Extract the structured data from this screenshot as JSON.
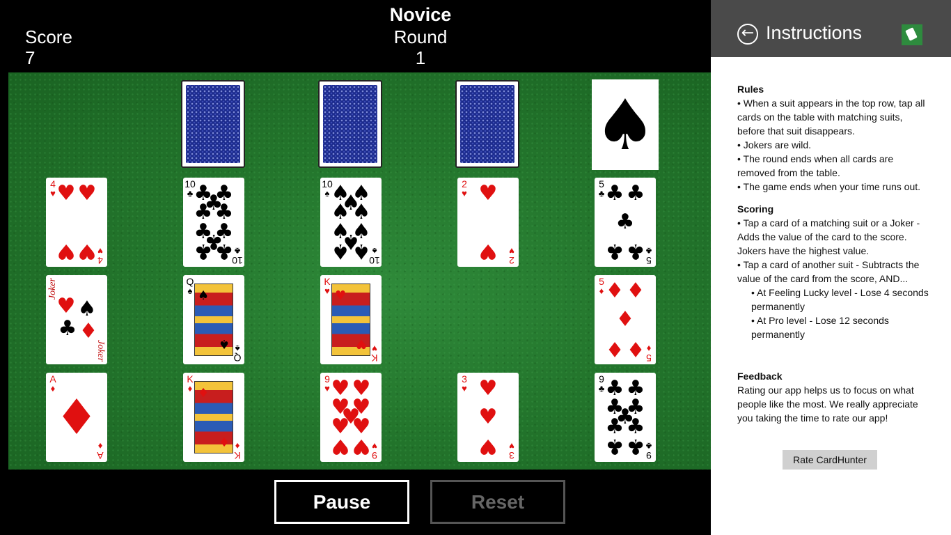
{
  "header": {
    "score_label": "Score",
    "score_value": "7",
    "level": "Novice",
    "round_label": "Round",
    "round_value": "1"
  },
  "top_row": {
    "face_down_cards": 3,
    "active_suit": "♠"
  },
  "table_cards": [
    {
      "rank": "4",
      "suit": "♥",
      "color": "red"
    },
    {
      "rank": "10",
      "suit": "♣",
      "color": "black"
    },
    {
      "rank": "10",
      "suit": "♠",
      "color": "black"
    },
    {
      "rank": "2",
      "suit": "♥",
      "color": "red"
    },
    {
      "rank": "5",
      "suit": "♣",
      "color": "black"
    },
    {
      "rank": "Joker",
      "suit": "",
      "color": "red"
    },
    {
      "rank": "Q",
      "suit": "♠",
      "color": "black"
    },
    {
      "rank": "K",
      "suit": "♥",
      "color": "red"
    },
    {
      "rank": "",
      "suit": "",
      "color": ""
    },
    {
      "rank": "5",
      "suit": "♦",
      "color": "red"
    },
    {
      "rank": "A",
      "suit": "♦",
      "color": "red"
    },
    {
      "rank": "K",
      "suit": "♦",
      "color": "red"
    },
    {
      "rank": "9",
      "suit": "♥",
      "color": "red"
    },
    {
      "rank": "3",
      "suit": "♥",
      "color": "red"
    },
    {
      "rank": "9",
      "suit": "♣",
      "color": "black"
    }
  ],
  "buttons": {
    "pause": "Pause",
    "reset": "Reset"
  },
  "panel": {
    "title": "Instructions",
    "rules_title": "Rules",
    "rules": [
      "• When a suit appears in the top row, tap all cards on the table with matching suits, before that suit disappears.",
      "• Jokers are wild.",
      "• The round ends when all cards are removed from the table.",
      "• The game ends when your time runs out."
    ],
    "scoring_title": "Scoring",
    "scoring": [
      "• Tap a card of a matching suit or a Joker - Adds the value of the card to the score. Jokers have the highest value.",
      "• Tap a card of another suit - Subtracts the value of the card from the score, AND..."
    ],
    "scoring_sub": [
      "• At Feeling Lucky level - Lose 4 seconds permanently",
      "• At Pro level - Lose 12 seconds permanently"
    ],
    "feedback_title": "Feedback",
    "feedback_text": "Rating our app helps us to focus on what people like the most. We really appreciate you taking the time to rate our app!",
    "rate_button": "Rate CardHunter"
  },
  "colors": {
    "felt": "#23752c",
    "red_suit": "#e01010",
    "panel_header": "#4a4a4a",
    "card_back": "#1b2a8c"
  }
}
